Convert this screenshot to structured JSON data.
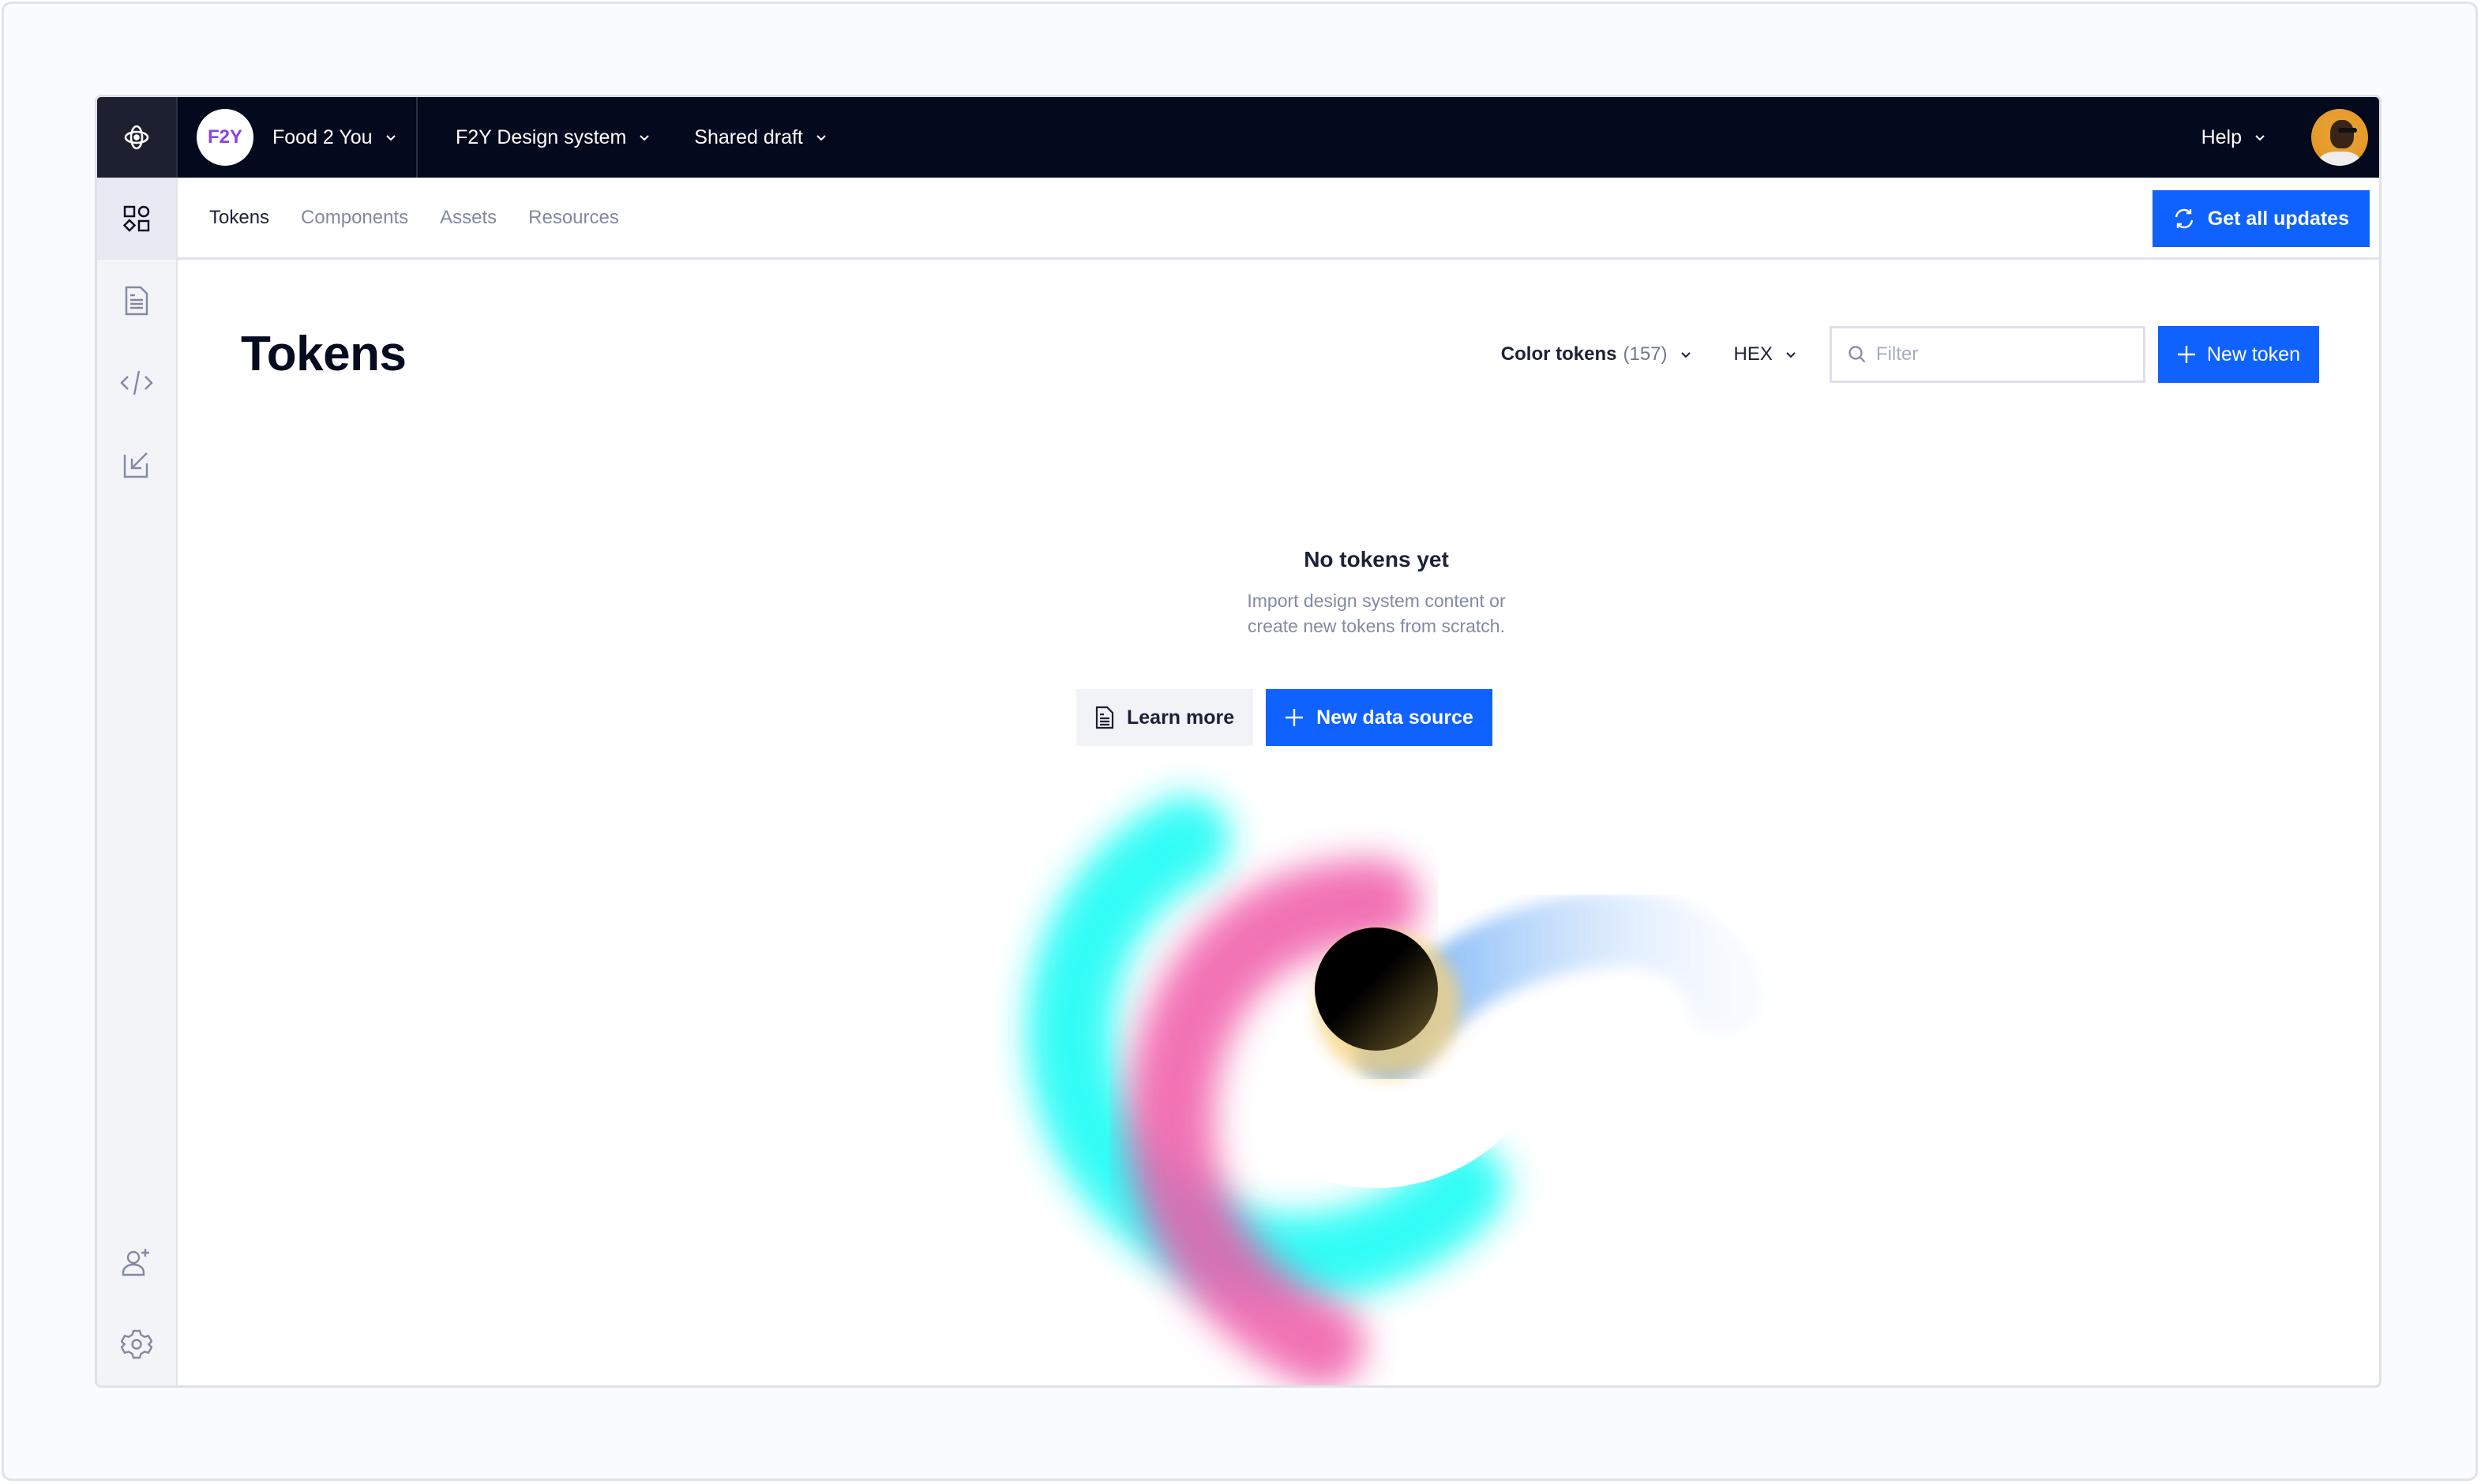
{
  "topbar": {
    "logo_icon": "app-logo-icon",
    "workspace": {
      "badge": "F2Y",
      "name": "Food 2 You"
    },
    "design_system": "F2Y Design system",
    "version": "Shared draft",
    "help": "Help",
    "avatar_icon": "user-avatar"
  },
  "rail": {
    "items": [
      {
        "icon": "tokens-shapes-icon",
        "active": true
      },
      {
        "icon": "document-icon"
      },
      {
        "icon": "code-icon"
      },
      {
        "icon": "import-arrow-icon"
      }
    ],
    "bottom": [
      {
        "icon": "add-user-icon"
      },
      {
        "icon": "gear-icon"
      }
    ]
  },
  "subnav": {
    "tabs": [
      {
        "label": "Tokens",
        "active": true
      },
      {
        "label": "Components"
      },
      {
        "label": "Assets"
      },
      {
        "label": "Resources"
      }
    ],
    "get_updates": "Get all updates"
  },
  "main": {
    "title": "Tokens",
    "token_type": {
      "label": "Color tokens",
      "count": "(157)"
    },
    "format": "HEX",
    "filter": {
      "placeholder": "Filter",
      "value": ""
    },
    "new_token": "New token"
  },
  "empty_state": {
    "title": "No tokens yet",
    "description_line1": "Import design system content or",
    "description_line2": "create new tokens from scratch.",
    "learn_more": "Learn more",
    "new_data_source": "New data source"
  },
  "colors": {
    "accent": "#0f62fe",
    "topbar": "#040a1e",
    "workspace_badge": "#8c43e6"
  }
}
